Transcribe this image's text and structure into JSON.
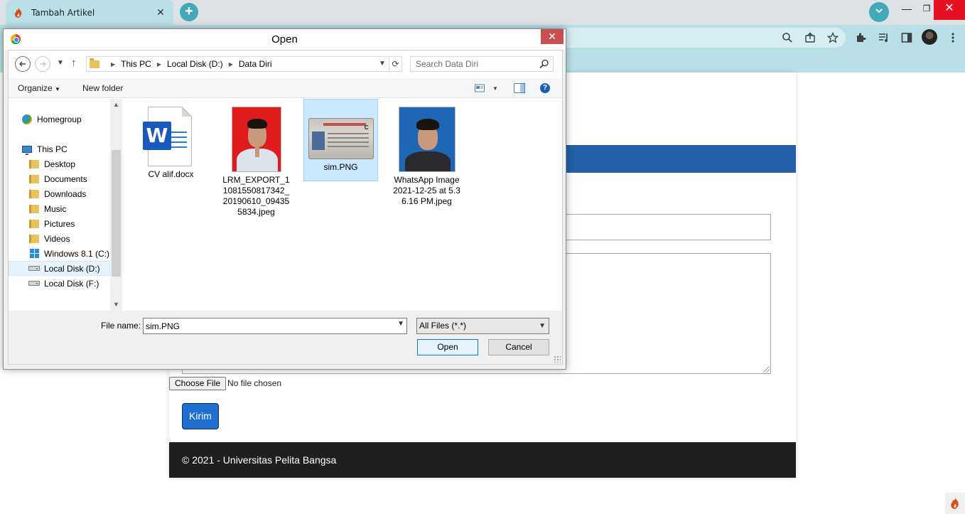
{
  "browser": {
    "tab_title": "Tambah Artikel",
    "tab_close": "✕",
    "new_tab": "+",
    "window_controls": {
      "minimize": "—",
      "maximize": "❐",
      "close": "✕"
    }
  },
  "page": {
    "choose_file_label": "Choose File",
    "no_file_text": "No file chosen",
    "submit_label": "Kirim",
    "footer_text": "© 2021 - Universitas Pelita Bangsa",
    "banner_color": "#2460a7",
    "submit_color": "#1f6fd1"
  },
  "dialog": {
    "title": "Open",
    "close": "✕",
    "breadcrumb": [
      "This PC",
      "Local Disk (D:)",
      "Data Diri"
    ],
    "search_placeholder": "Search Data Diri",
    "commands": {
      "organize": "Organize",
      "new_folder": "New folder"
    },
    "nav_items": [
      {
        "label": "Homegroup",
        "icon": "homegroup-icon"
      },
      {
        "label": "This PC",
        "icon": "computer-icon"
      },
      {
        "label": "Desktop",
        "icon": "folder-icon"
      },
      {
        "label": "Documents",
        "icon": "folder-icon"
      },
      {
        "label": "Downloads",
        "icon": "folder-icon"
      },
      {
        "label": "Music",
        "icon": "folder-icon"
      },
      {
        "label": "Pictures",
        "icon": "folder-icon"
      },
      {
        "label": "Videos",
        "icon": "folder-icon"
      },
      {
        "label": "Windows 8.1 (C:)",
        "icon": "windows-drive-icon"
      },
      {
        "label": "Local Disk (D:)",
        "icon": "drive-icon",
        "selected": true
      },
      {
        "label": "Local Disk (F:)",
        "icon": "drive-icon"
      }
    ],
    "files": [
      {
        "name": "CV alif.docx",
        "type": "word-document"
      },
      {
        "name": "LRM_EXPORT_11081550817342_20190610_094355834.jpeg",
        "type": "photo"
      },
      {
        "name": "sim.PNG",
        "type": "image",
        "selected": true
      },
      {
        "name": "WhatsApp Image 2021-12-25 at 5.36.16 PM.jpeg",
        "type": "photo"
      }
    ],
    "file_name_label": "File name:",
    "file_name_value": "sim.PNG",
    "file_type": "All Files (*.*)",
    "open_label": "Open",
    "cancel_label": "Cancel"
  }
}
